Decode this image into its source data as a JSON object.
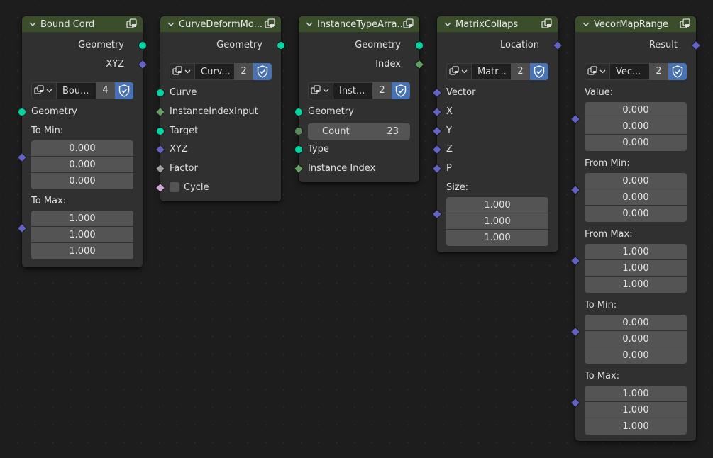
{
  "nodes": {
    "bound_cord": {
      "title": "Bound Cord",
      "outputs": [
        "Geometry",
        "XYZ"
      ],
      "group": {
        "name": "Bou...",
        "users": "4"
      },
      "input_geometry": "Geometry",
      "to_min_label": "To Min:",
      "to_min": [
        "0.000",
        "0.000",
        "0.000"
      ],
      "to_max_label": "To Max:",
      "to_max": [
        "1.000",
        "1.000",
        "1.000"
      ]
    },
    "curve_deform": {
      "title": "CurveDeformMo...",
      "outputs": [
        "Geometry"
      ],
      "group": {
        "name": "Curv...",
        "users": "2"
      },
      "inputs": [
        "Curve",
        "InstanceIndexInput",
        "Target",
        "XYZ",
        "Factor"
      ],
      "cycle_label": "Cycle"
    },
    "instance_type": {
      "title": "InstanceTypeArra...",
      "outputs": [
        "Geometry",
        "Index"
      ],
      "group": {
        "name": "Inst...",
        "users": "2"
      },
      "input_geometry": "Geometry",
      "count_label": "Count",
      "count_value": "23",
      "input_type": "Type",
      "input_instance_index": "Instance Index"
    },
    "matrix_collapse": {
      "title": "MatrixCollaps",
      "outputs": [
        "Location"
      ],
      "group": {
        "name": "Matr...",
        "users": "2"
      },
      "inputs": [
        "Vector",
        "X",
        "Y",
        "Z",
        "P"
      ],
      "size_label": "Size:",
      "size": [
        "1.000",
        "1.000",
        "1.000"
      ]
    },
    "vector_map_range": {
      "title": "VecorMapRange",
      "outputs": [
        "Result"
      ],
      "group": {
        "name": "Vec...",
        "users": "2"
      },
      "value_label": "Value:",
      "value": [
        "0.000",
        "0.000",
        "0.000"
      ],
      "from_min_label": "From Min:",
      "from_min": [
        "0.000",
        "0.000",
        "0.000"
      ],
      "from_max_label": "From Max:",
      "from_max": [
        "1.000",
        "1.000",
        "1.000"
      ],
      "to_min_label": "To Min:",
      "to_min": [
        "0.000",
        "0.000",
        "0.000"
      ],
      "to_max_label": "To Max:",
      "to_max": [
        "1.000",
        "1.000",
        "1.000"
      ]
    }
  },
  "colors": {
    "geometry_socket": "#00d6a3",
    "vector_socket": "#6363c7",
    "integer_socket": "#63a063",
    "float_socket": "#a1a1a1",
    "boolean_socket": "#cca6d6",
    "header": "#3a4e2c",
    "fake_user_shield": "#4772b3"
  },
  "icons": [
    "chevron-down-icon",
    "node-group-icon",
    "fake-user-shield-icon"
  ]
}
